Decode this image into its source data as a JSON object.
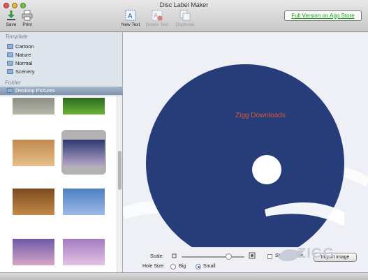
{
  "window": {
    "title": "Disc Label Maker"
  },
  "toolbar": {
    "save_label": "Save",
    "print_label": "Print",
    "new_text_label": "New Text",
    "delete_text_label": "Delete Text",
    "duplicate_label": "Duplicate"
  },
  "appstore_link": "Full Version on App Store",
  "sidebar": {
    "template_header": "Template",
    "template_items": [
      "Cartoon",
      "Nature",
      "Normal",
      "Scenery"
    ],
    "folder_header": "Folder",
    "folder_selected": "Desktop Pictures"
  },
  "thumbnails": [
    {
      "name": "rocks",
      "colors": [
        "#8a8f86",
        "#b7b6a8"
      ]
    },
    {
      "name": "grass",
      "colors": [
        "#2d6a1f",
        "#6bb43b"
      ]
    },
    {
      "name": "lake-island",
      "colors": [
        "#c08a4e",
        "#e7c08a"
      ]
    },
    {
      "name": "mountain-dusk",
      "colors": [
        "#2c3a72",
        "#b8a6c8"
      ]
    },
    {
      "name": "lion",
      "colors": [
        "#7a4a1e",
        "#c48a4a"
      ]
    },
    {
      "name": "blue-sky",
      "colors": [
        "#4d7fc3",
        "#9dbbe6"
      ]
    },
    {
      "name": "mount-fuji",
      "colors": [
        "#6d5aa8",
        "#d8a6c6"
      ]
    },
    {
      "name": "misty-trees",
      "colors": [
        "#a37cc0",
        "#e1c4e4"
      ]
    }
  ],
  "disc": {
    "text": "Zigg Downloads",
    "color": "#263d7a",
    "text_color": "#d35a3c"
  },
  "controls": {
    "scale_label": "Scale:",
    "hole_size_label": "Hole Size:",
    "big_label": "Big",
    "small_label": "Small",
    "hole_size_selected": "Small",
    "show_outline_label": "Show outline",
    "show_outline_checked": false,
    "import_label": "Import image",
    "scale_value": 0.75
  },
  "watermark": "ZIGG",
  "colors": {
    "appstore_link": "#18a318",
    "selection": "#8296ae"
  }
}
